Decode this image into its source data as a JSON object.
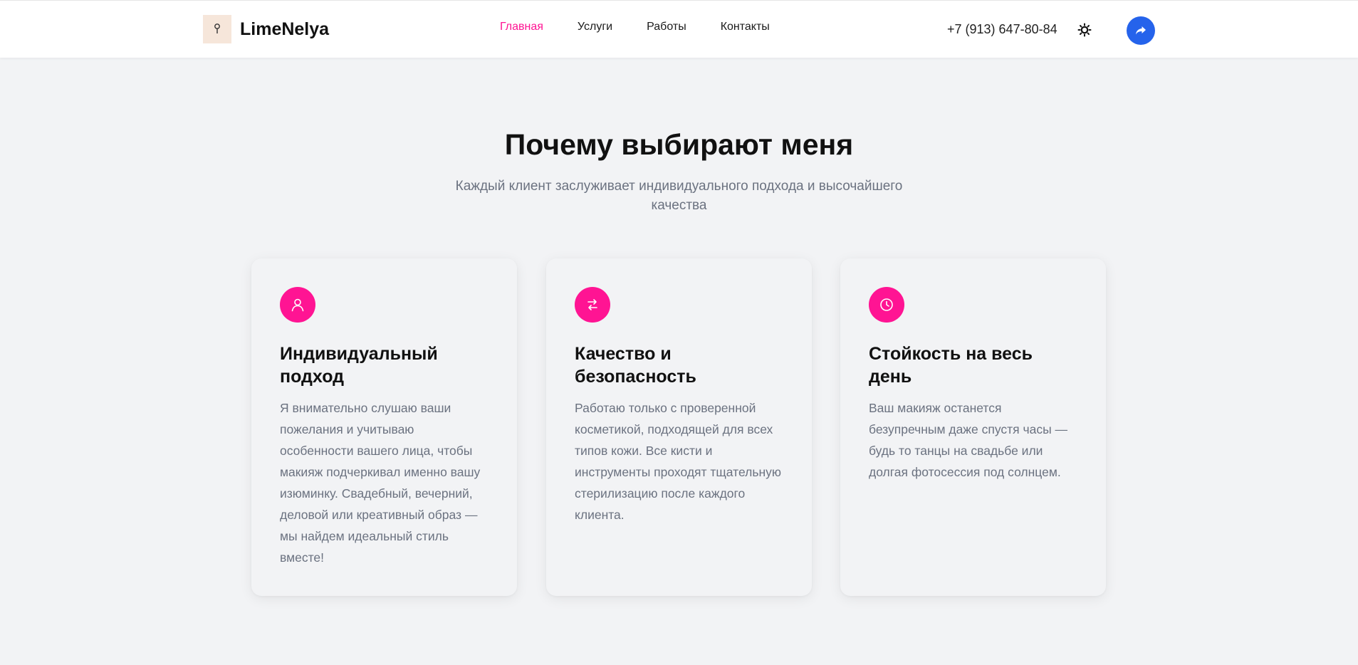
{
  "header": {
    "brand": "LimeNelya",
    "nav": [
      {
        "label": "Главная",
        "active": true
      },
      {
        "label": "Услуги",
        "active": false
      },
      {
        "label": "Работы",
        "active": false
      },
      {
        "label": "Контакты",
        "active": false
      }
    ],
    "phone": "+7 (913) 647-80-84",
    "theme_icon": "sun-icon",
    "share_icon": "share-arrow-icon"
  },
  "section": {
    "title": "Почему выбирают меня",
    "subtitle": "Каждый клиент заслуживает индивидуального подхода и высочайшего качества"
  },
  "features": [
    {
      "icon": "user-icon",
      "title": "Индивидуальный подход",
      "text": "Я внимательно слушаю ваши пожелания и учитываю особенности вашего лица, чтобы макияж подчеркивал именно вашу изюминку. Свадебный, вечерний, деловой или креативный образ — мы найдем идеальный стиль вместе!"
    },
    {
      "icon": "arrows-exchange-icon",
      "title": "Качество и безопасность",
      "text": "Работаю только с проверенной косметикой, подходящей для всех типов кожи. Все кисти и инструменты проходят тщательную стерилизацию после каждого клиента."
    },
    {
      "icon": "clock-icon",
      "title": "Стойкость на весь день",
      "text": "Ваш макияж останется безупречным даже спустя часы — будь то танцы на свадьбе или долгая фотосессия под солнцем."
    }
  ],
  "colors": {
    "accent": "#ff1493",
    "button": "#2563eb",
    "background": "#f2f3f5",
    "muted_text": "#6b7280"
  }
}
